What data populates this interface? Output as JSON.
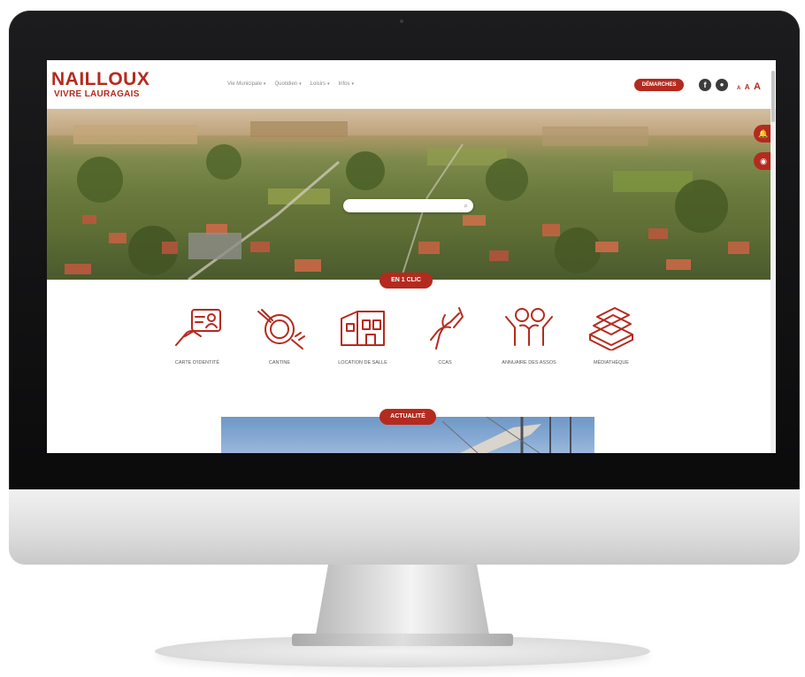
{
  "site": {
    "logo_title": "NAILLOUX",
    "logo_subtitle": "VIVRE LAURAGAIS"
  },
  "nav": {
    "items": [
      {
        "label": "Vie Municipale"
      },
      {
        "label": "Quotidien"
      },
      {
        "label": "Loisirs"
      },
      {
        "label": "Infos"
      }
    ],
    "caret": "▾"
  },
  "header": {
    "demarches_label": "DÉMARCHES",
    "facebook_glyph": "f",
    "account_glyph": "●",
    "font_small": "A",
    "font_medium": "A",
    "font_large": "A"
  },
  "search": {
    "placeholder": "",
    "icon_glyph": "⌕"
  },
  "side": {
    "alert_glyph": "🔔",
    "view_glyph": "◉"
  },
  "sections": {
    "quick_links_title": "EN 1 CLIC",
    "news_title": "ACTUALITÉ"
  },
  "quick_links": [
    {
      "label": "CARTE D'IDENTITÉ",
      "icon": "id-card-icon"
    },
    {
      "label": "CANTINE",
      "icon": "plate-cutlery-icon"
    },
    {
      "label": "LOCATION DE SALLE",
      "icon": "building-icon"
    },
    {
      "label": "CCAS",
      "icon": "helping-hands-icon"
    },
    {
      "label": "ANNUAIRE DES ASSOS",
      "icon": "people-icon"
    },
    {
      "label": "MÉDIATHÈQUE",
      "icon": "books-icon"
    }
  ],
  "colors": {
    "brand": "#b52a1e",
    "bezel": "#111111"
  }
}
